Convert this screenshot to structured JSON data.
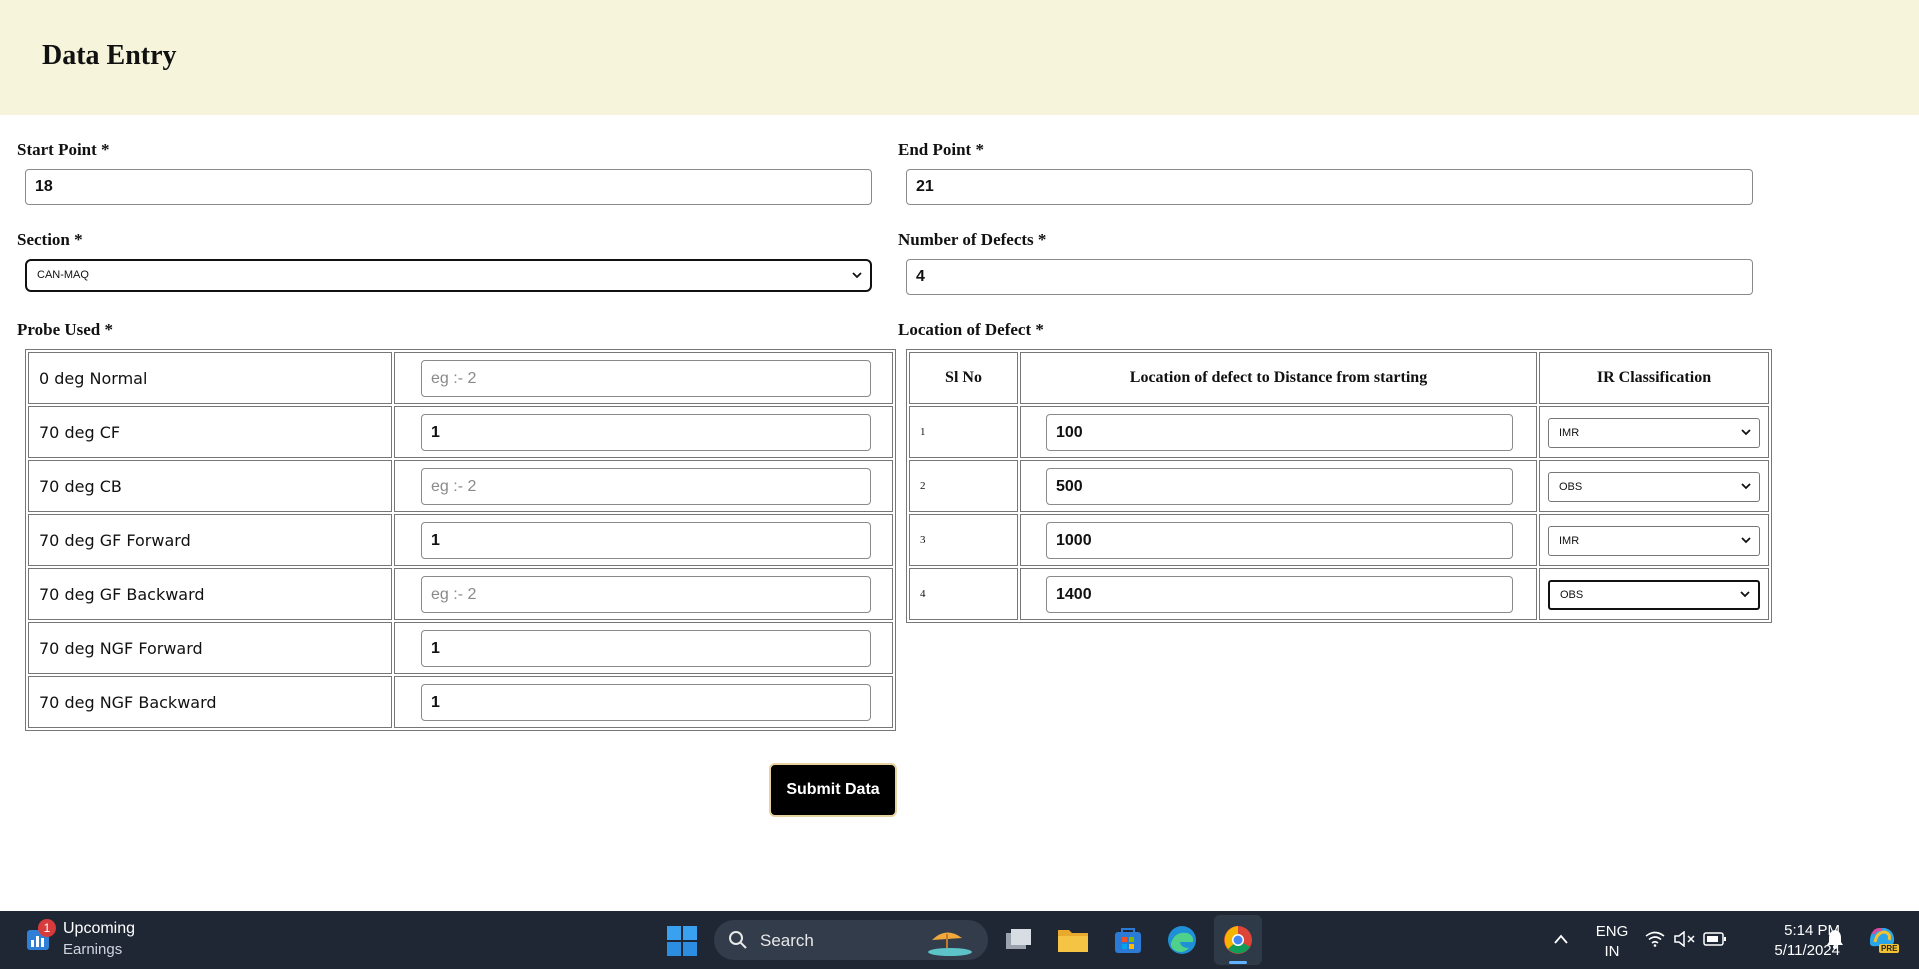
{
  "page": {
    "title": "Data Entry"
  },
  "form": {
    "start_point": {
      "label": "Start Point *",
      "value": "18"
    },
    "end_point": {
      "label": "End Point *",
      "value": "21"
    },
    "section": {
      "label": "Section *",
      "value": "CAN-MAQ"
    },
    "num_defects": {
      "label": "Number of Defects *",
      "value": "4"
    },
    "probe": {
      "label": "Probe Used *",
      "placeholder": "eg :- 2",
      "rows": [
        {
          "name": "0 deg Normal",
          "value": ""
        },
        {
          "name": "70 deg CF",
          "value": "1"
        },
        {
          "name": "70 deg CB",
          "value": ""
        },
        {
          "name": "70 deg GF Forward",
          "value": "1"
        },
        {
          "name": "70 deg GF Backward",
          "value": ""
        },
        {
          "name": "70 deg NGF Forward",
          "value": "1"
        },
        {
          "name": "70 deg NGF Backward",
          "value": "1"
        }
      ]
    },
    "location": {
      "label": "Location of Defect *",
      "headers": {
        "sl": "Sl No",
        "loc": "Location of defect to Distance from starting",
        "ir": "IR Classification"
      },
      "rows": [
        {
          "sl": "1",
          "loc": "100",
          "ir": "IMR"
        },
        {
          "sl": "2",
          "loc": "500",
          "ir": "OBS"
        },
        {
          "sl": "3",
          "loc": "1000",
          "ir": "IMR"
        },
        {
          "sl": "4",
          "loc": "1400",
          "ir": "OBS"
        }
      ]
    },
    "submit_label": "Submit Data"
  },
  "taskbar": {
    "widget": {
      "title": "Upcoming",
      "subtitle": "Earnings",
      "badge": "1"
    },
    "search_label": "Search",
    "lang": {
      "line1": "ENG",
      "line2": "IN"
    },
    "time": "5:14 PM",
    "date": "5/11/2024",
    "copilot_badge": "PRE"
  },
  "colors": {
    "header_bg": "#f6f5dc",
    "taskbar_bg": "#1f2734",
    "submit_bg": "#000000",
    "accent_blue": "#0078d4"
  }
}
